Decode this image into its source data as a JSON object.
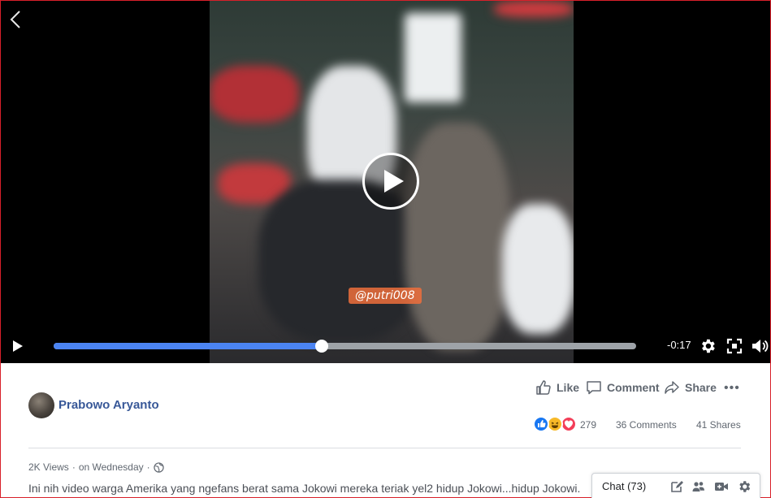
{
  "video": {
    "watermark_text": "@putri008",
    "time_remaining": "-0:17",
    "progress": 0.46
  },
  "post": {
    "author": "Prabowo Aryanto",
    "actions": {
      "like": "Like",
      "comment": "Comment",
      "share": "Share",
      "more": "•••"
    },
    "reactions": {
      "count": "279",
      "types": [
        "like-icon",
        "haha-icon",
        "love-icon"
      ]
    },
    "comments": "36 Comments",
    "shares": "41 Shares",
    "views": "2K Views",
    "time": "on Wednesday",
    "separator": "·",
    "caption": "Ini nih video warga Amerika yang ngefans berat sama Jokowi mereka teriak yel2 hidup Jokowi...hidup Jokowi."
  },
  "chat": {
    "label": "Chat (73)"
  },
  "colors": {
    "accent": "#385898",
    "progress": "#4b84f2",
    "like": "#1877f2",
    "love": "#f33e58",
    "haha": "#f7b928"
  }
}
